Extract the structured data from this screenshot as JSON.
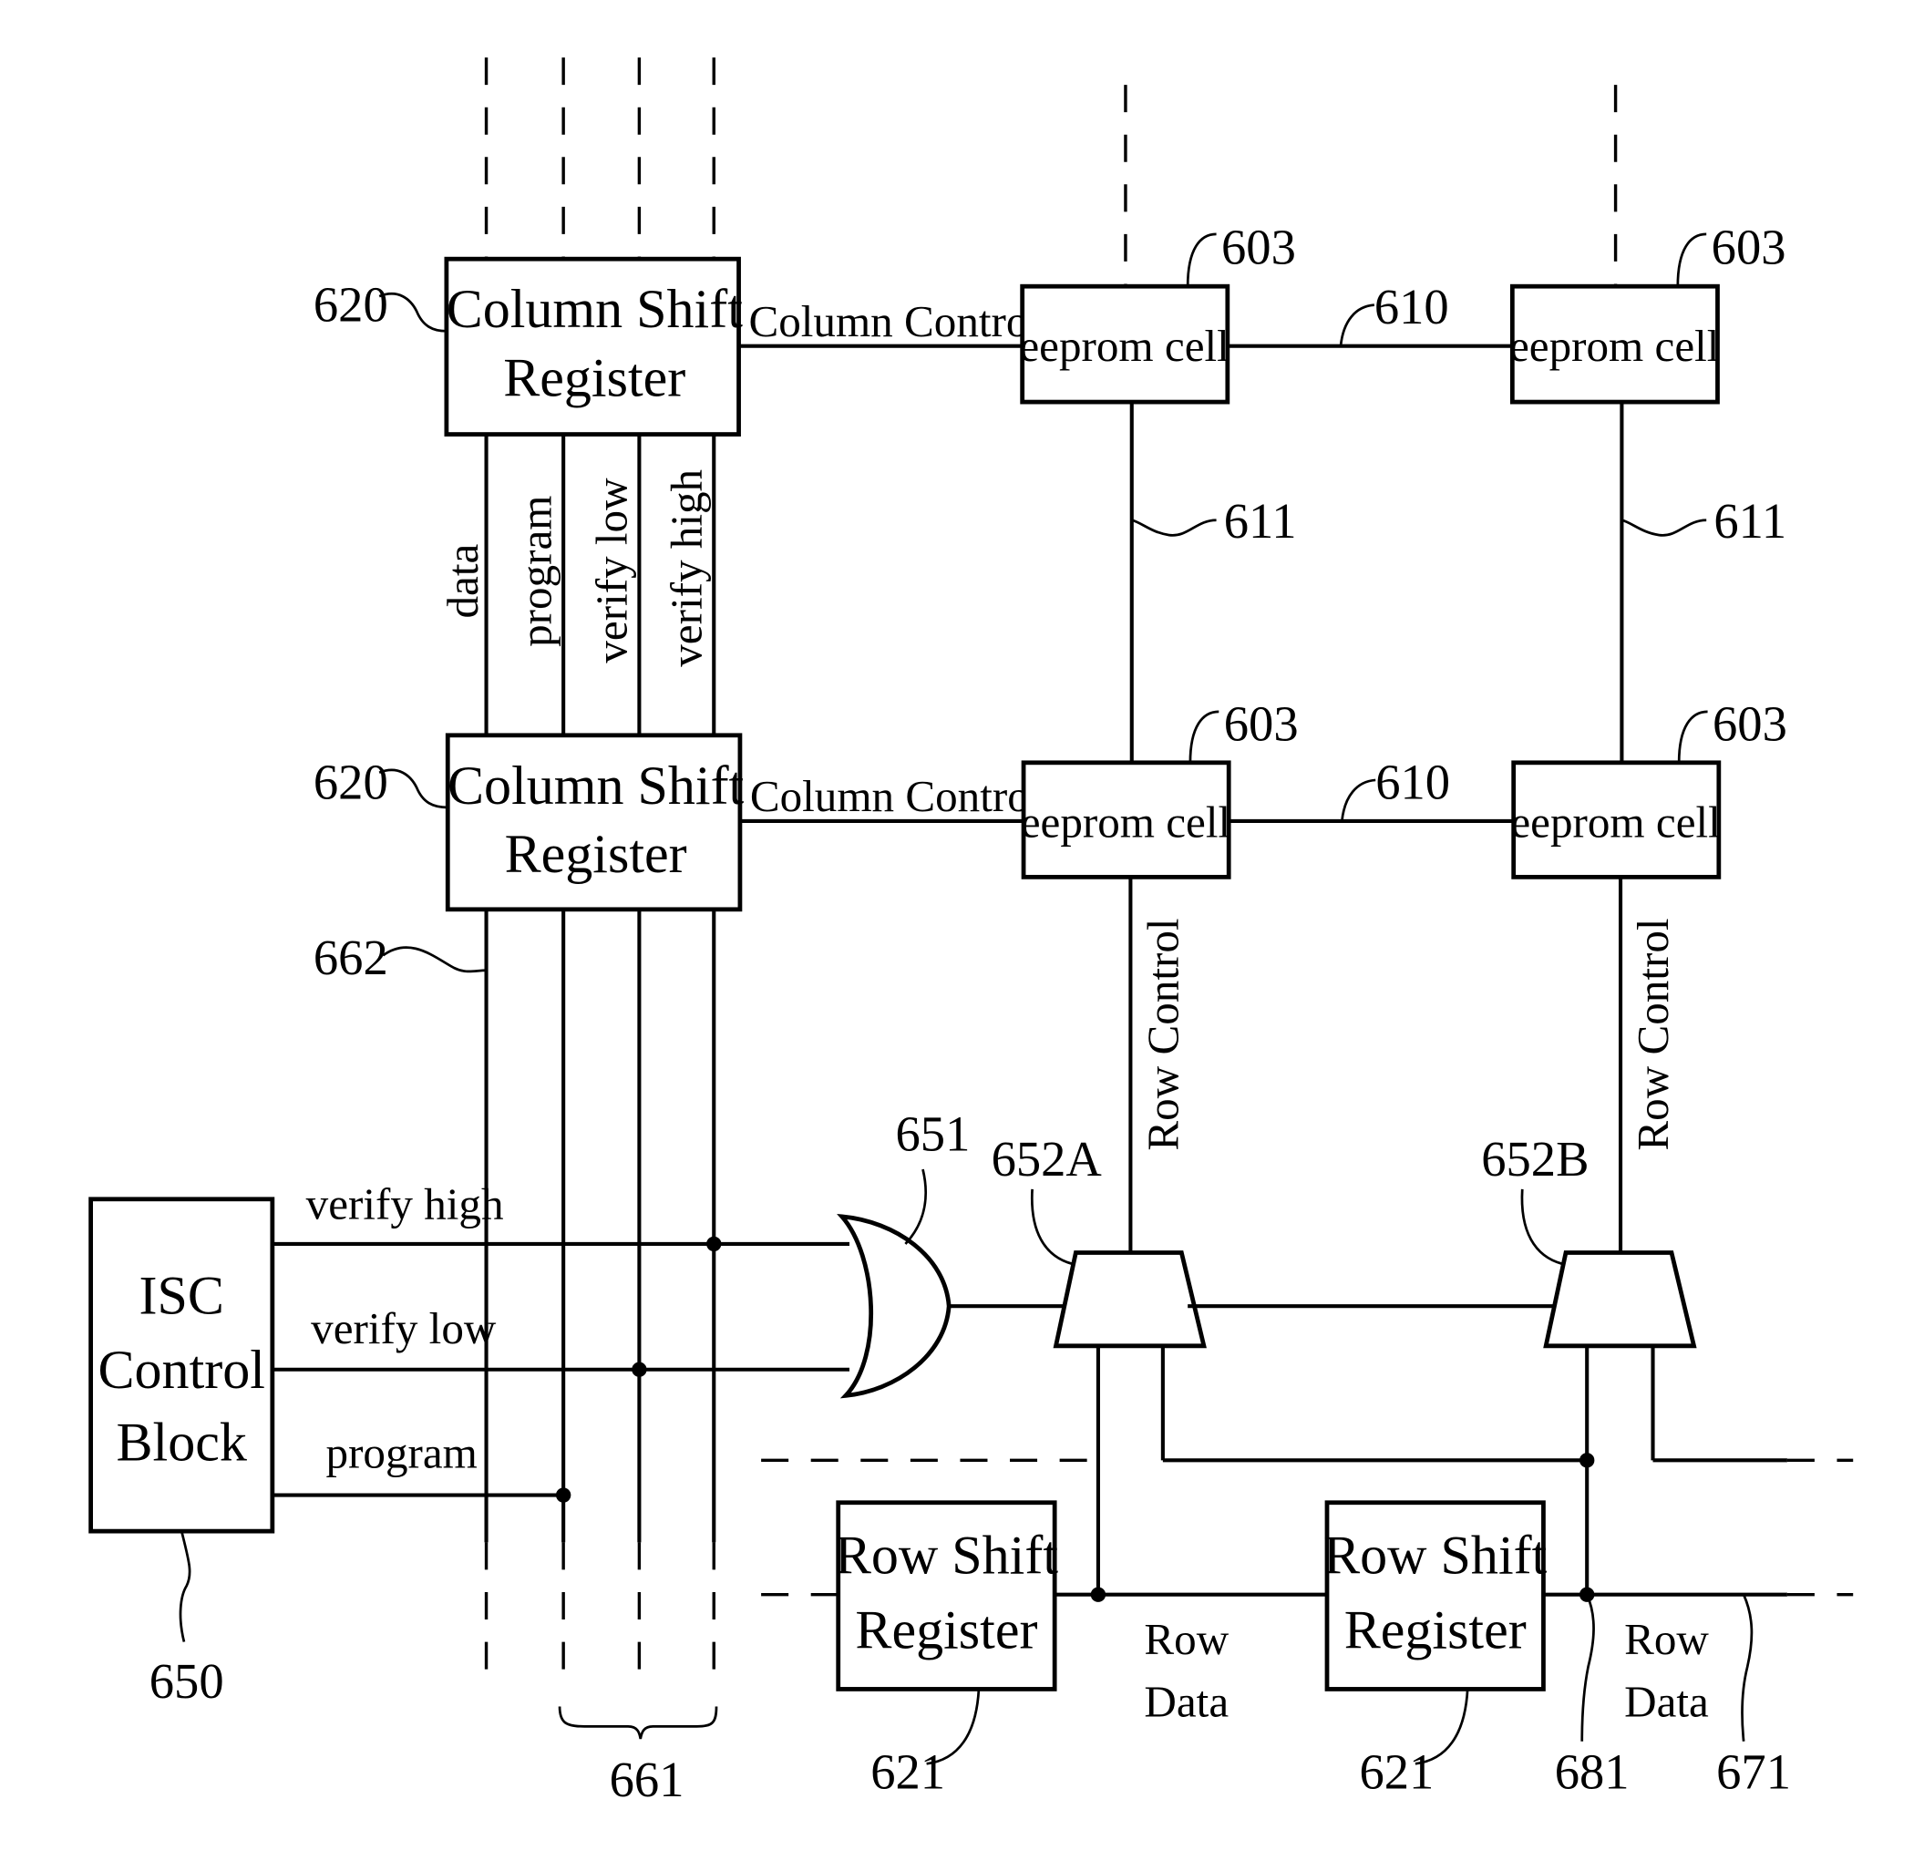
{
  "figure": {
    "column_shift_registers": [
      {
        "line1": "Column Shift",
        "line2": "Register",
        "ref": "620",
        "output_label": "Column Control"
      },
      {
        "line1": "Column Shift",
        "line2": "Register",
        "ref": "620",
        "output_label": "Column Control"
      }
    ],
    "eeprom_cells": [
      {
        "label": "eeprom cell",
        "ref": "603"
      },
      {
        "label": "eeprom cell",
        "ref": "603"
      },
      {
        "label": "eeprom cell",
        "ref": "603"
      },
      {
        "label": "eeprom cell",
        "ref": "603"
      }
    ],
    "refs": {
      "row_line": "610",
      "column_line": "611",
      "bus_line": "662",
      "bus_group": "661",
      "or_gate": "651",
      "mux_a": "652A",
      "mux_b": "652B",
      "isc_block": "650",
      "row_shift_register": "621",
      "node": "681",
      "row_data_line": "671"
    },
    "bus_signals": [
      "data",
      "program",
      "verify low",
      "verify high"
    ],
    "isc_block": {
      "line1": "ISC",
      "line2": "Control",
      "line3": "Block"
    },
    "isc_outputs": [
      "verify high",
      "verify low",
      "program"
    ],
    "row_control_label": "Row Control",
    "row_shift_registers": [
      {
        "line1": "Row Shift",
        "line2": "Register",
        "ref": "621"
      },
      {
        "line1": "Row Shift",
        "line2": "Register",
        "ref": "621"
      }
    ],
    "row_data_label": {
      "line1": "Row",
      "line2": "Data"
    }
  }
}
